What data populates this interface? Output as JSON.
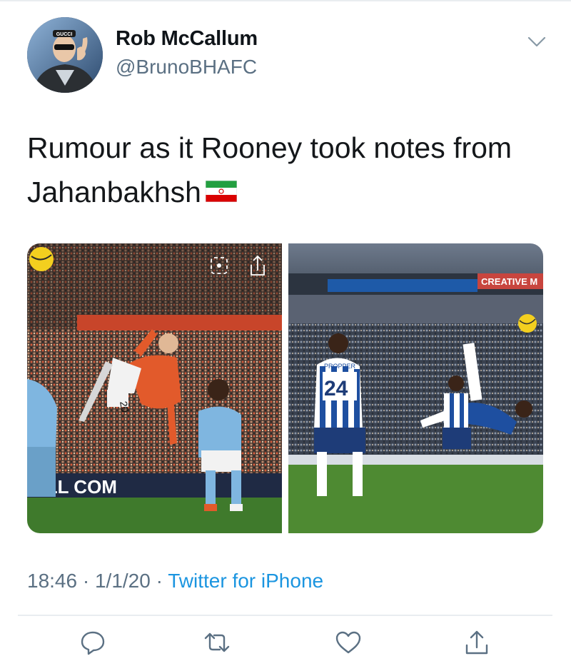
{
  "user": {
    "display_name": "Rob McCallum",
    "handle": "@BrunoBHAFC"
  },
  "tweet": {
    "text": "Rumour as it Rooney took notes from Jahanbakhsh"
  },
  "media": {
    "left": {
      "shirt_number": "20",
      "hoarding": "ALL COM"
    },
    "right": {
      "shirt_number": "24",
      "shirt_name": "PROPPER",
      "hoarding": "CREATIVE M"
    }
  },
  "meta": {
    "time": "18:46",
    "separator": "·",
    "date": "1/1/20",
    "source": "Twitter for iPhone"
  },
  "icons": {
    "more": "chevron-down-icon",
    "reply": "reply-icon",
    "retweet": "retweet-icon",
    "like": "like-icon",
    "share": "share-icon",
    "flag": "iran-flag-icon"
  },
  "colors": {
    "text": "#14171a",
    "secondary": "#5b7083",
    "link": "#1b95e0",
    "divider": "#e9edf0"
  }
}
